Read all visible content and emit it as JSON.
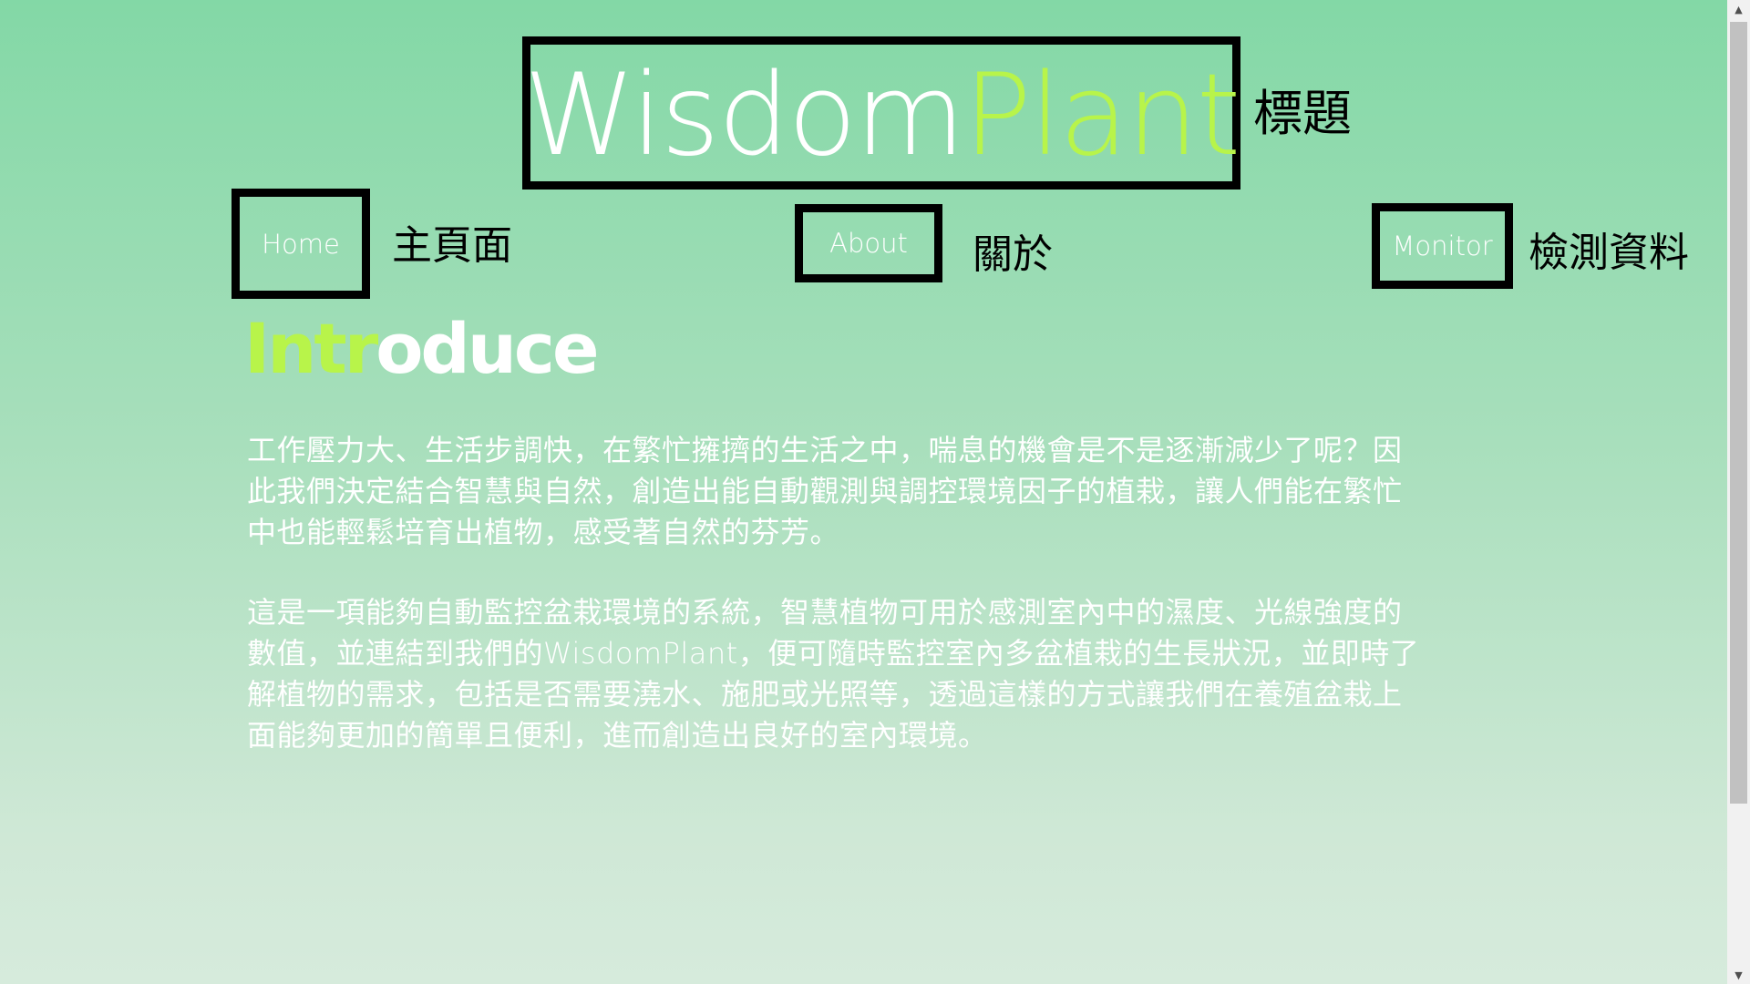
{
  "logo": {
    "part1": "Wisdom",
    "part2": "Plant",
    "annotation": "標題"
  },
  "nav": {
    "home_label": "Home",
    "home_annotation": "主頁面",
    "about_label": "About",
    "about_annotation": "關於",
    "monitor_label": "Monitor",
    "monitor_annotation": "檢測資料"
  },
  "intro": {
    "heading_part1": "Intr",
    "heading_part2": "oduce",
    "paragraph1": "工作壓力大、生活步調快，在繁忙擁擠的生活之中，喘息的機會是不是逐漸減少了呢？因此我們決定結合智慧與自然，創造出能自動觀測與調控環境因子的植栽，讓人們能在繁忙中也能輕鬆培育出植物，感受著自然的芬芳。",
    "paragraph2": "這是一項能夠自動監控盆栽環境的系統，智慧植物可用於感測室內中的濕度、光線強度的數值，並連結到我們的WisdomPlant，便可隨時監控室內多盆植栽的生長狀況，並即時了解植物的需求，包括是否需要澆水、施肥或光照等，透過這樣的方式讓我們在養殖盆栽上面能夠更加的簡單且便利，進而創造出良好的室內環境。"
  },
  "colors": {
    "accent_green": "#b8f44a",
    "background_top": "#83d8a6",
    "background_bottom": "#d6ebdc",
    "border": "#000000"
  },
  "scrollbar": {
    "up_icon": "triangle-up-icon",
    "down_icon": "triangle-down-icon"
  }
}
